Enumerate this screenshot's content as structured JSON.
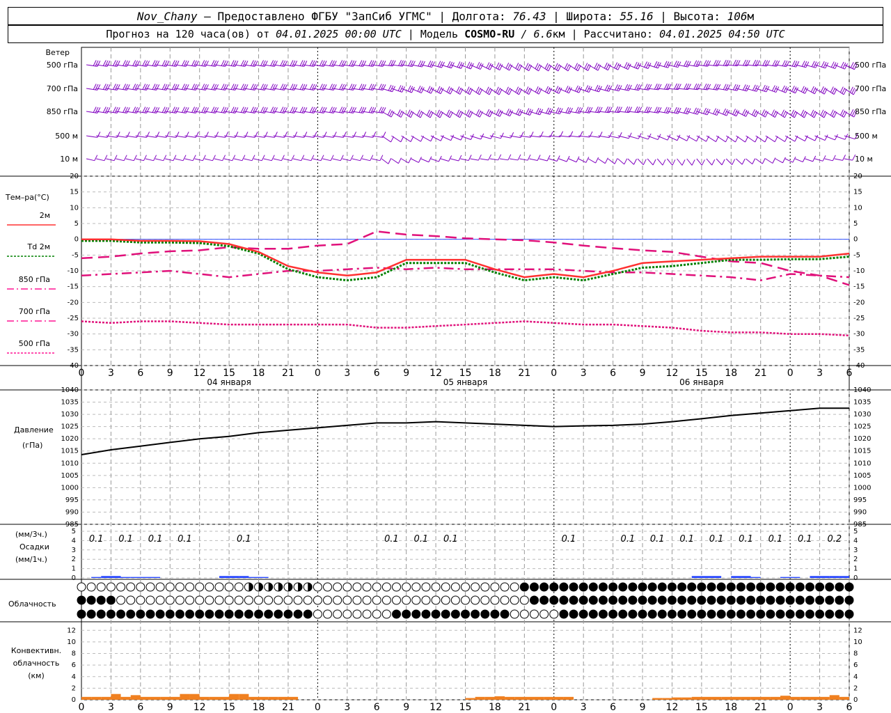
{
  "header": {
    "station": "Nov_Chany",
    "dash": " – ",
    "provider": "Предоставлено ФГБУ \"ЗапСиб УГМС\"",
    "sep": " | ",
    "lon_label": "Долгота: ",
    "lon": "76.43",
    "lat_label": "Широта: ",
    "lat": "55.16",
    "alt_label": "Высота: ",
    "alt": "106",
    "alt_unit": "м",
    "forecast_label": "Прогноз на 120 часа(ов) от ",
    "forecast_start": "04.01.2025 00:00 UTC",
    "model_label": " | Модель ",
    "model": "COSMO-RU",
    "model_sep": " / ",
    "resolution": "6.6",
    "resolution_unit": "км",
    "computed_label": " | Рассчитано: ",
    "computed": "04.01.2025 04:50 UTC"
  },
  "wind_panel": {
    "title": "Ветер",
    "levels": [
      "500 гПа",
      "700 гПа",
      "850 гПа",
      "500  м",
      "10  м"
    ],
    "right_levels": [
      "500 гПа",
      "700 гПа",
      "850 гПа",
      "500 м",
      "10 м"
    ],
    "color": "#8000c0",
    "calm_marker_hour": 96
  },
  "temp_panel": {
    "title": "Тем–ра(°C)",
    "legend": [
      {
        "label": "2м",
        "color": "#ff3030",
        "style": "solid"
      },
      {
        "label": "Td  2м",
        "color": "#008000",
        "style": "dotted"
      },
      {
        "label": "850 гПа",
        "color": "#ff1493",
        "style": "dashdot"
      },
      {
        "label": "700 гПа",
        "color": "#ff1493",
        "style": "dashdot"
      },
      {
        "label": "500 гПа",
        "color": "#ff1493",
        "style": "dotted"
      }
    ],
    "yticks": [
      "20",
      "15",
      "10",
      "5",
      "0",
      "-5",
      "-10",
      "-15",
      "-20",
      "-25",
      "-30",
      "-35",
      "-40"
    ]
  },
  "time_axis": {
    "labels": [
      "0",
      "3",
      "6",
      "9",
      "12",
      "15",
      "18",
      "21",
      "0",
      "3",
      "6",
      "9",
      "12",
      "15",
      "18",
      "21",
      "0",
      "3",
      "6",
      "9",
      "12",
      "15",
      "18",
      "21",
      "0",
      "3",
      "6"
    ],
    "dates": [
      "04 января",
      "05 января",
      "06 января"
    ]
  },
  "pressure_panel": {
    "title": "Давление",
    "unit": "(гПа)",
    "yticks": [
      "1040",
      "1035",
      "1030",
      "1025",
      "1020",
      "1015",
      "1010",
      "1005",
      "1000",
      "995",
      "990",
      "985"
    ]
  },
  "precip_panel": {
    "unit_3h": "(мм/3ч.)",
    "title": "Осадки",
    "unit_1h": "(мм/1ч.)",
    "yticks": [
      "5",
      "4",
      "3",
      "2",
      "1",
      "0"
    ],
    "amounts": [
      {
        "hour": 1,
        "text": "0.1"
      },
      {
        "hour": 4,
        "text": "0.1"
      },
      {
        "hour": 7,
        "text": "0.1"
      },
      {
        "hour": 10,
        "text": "0.1"
      },
      {
        "hour": 16,
        "text": "0.1"
      },
      {
        "hour": 31,
        "text": "0.1"
      },
      {
        "hour": 34,
        "text": "0.1"
      },
      {
        "hour": 37,
        "text": "0.1"
      },
      {
        "hour": 49,
        "text": "0.1"
      },
      {
        "hour": 55,
        "text": "0.1"
      },
      {
        "hour": 58,
        "text": "0.1"
      },
      {
        "hour": 61,
        "text": "0.1"
      },
      {
        "hour": 64,
        "text": "0.1"
      },
      {
        "hour": 67,
        "text": "0.1"
      },
      {
        "hour": 70,
        "text": "0.1"
      },
      {
        "hour": 73,
        "text": "0.1"
      },
      {
        "hour": 76,
        "text": "0.2"
      }
    ]
  },
  "cloud_panel": {
    "title": "Облачность"
  },
  "conv_panel": {
    "title_lines": [
      "Конвективн.",
      "облачность",
      "(км)"
    ],
    "yticks": [
      "12",
      "10",
      "8",
      "6",
      "4",
      "2",
      "0"
    ]
  },
  "chart_data": {
    "type": "line",
    "x_hours": [
      0,
      3,
      6,
      9,
      12,
      15,
      18,
      21,
      24,
      27,
      30,
      33,
      36,
      39,
      42,
      45,
      48,
      51,
      54,
      57,
      60,
      63,
      66,
      69,
      72,
      75,
      78
    ],
    "t2m": [
      0,
      0,
      -0.5,
      -0.5,
      -0.6,
      -1.5,
      -4,
      -8.5,
      -10.5,
      -11.5,
      -10.5,
      -6.5,
      -6.5,
      -6.5,
      -9.5,
      -12,
      -11,
      -12,
      -10,
      -7.5,
      -7,
      -6.5,
      -6,
      -5.5,
      -5.5,
      -5.5,
      -4.5
    ],
    "td2m": [
      -0.5,
      -0.5,
      -1,
      -1,
      -1.2,
      -2.2,
      -4.5,
      -9.5,
      -12,
      -13,
      -12,
      -7.5,
      -7.5,
      -7.5,
      -10.5,
      -13,
      -12,
      -13,
      -11,
      -9,
      -8.5,
      -7.5,
      -6.5,
      -6.5,
      -6.3,
      -6.3,
      -5.5
    ],
    "t850": [
      -6,
      -5.5,
      -4.5,
      -3.8,
      -3.5,
      -2.5,
      -3,
      -3,
      -2,
      -1.5,
      2.5,
      1.5,
      1,
      0.3,
      0,
      -0.3,
      -1,
      -2,
      -2.8,
      -3.5,
      -4,
      -5.5,
      -7,
      -7.5,
      -10,
      -11.5,
      -14.5
    ],
    "t700": [
      -11.5,
      -11,
      -10.5,
      -10,
      -11,
      -12,
      -11,
      -10,
      -10,
      -9.5,
      -9,
      -9.5,
      -9,
      -9.5,
      -9.5,
      -9.5,
      -9.5,
      -10,
      -10.5,
      -10.5,
      -11,
      -11.5,
      -12,
      -13,
      -11,
      -11.5,
      -12
    ],
    "t500": [
      -26,
      -26.5,
      -26,
      -26,
      -26.5,
      -27,
      -27,
      -27,
      -27,
      -27,
      -28,
      -28,
      -27.5,
      -27,
      -26.5,
      -26,
      -26.5,
      -27,
      -27,
      -27.5,
      -28,
      -29,
      -29.5,
      -29.5,
      -30,
      -30,
      -30.5
    ],
    "pressure": [
      1013.5,
      1015.5,
      1017,
      1018.5,
      1020,
      1021,
      1022.5,
      1023.5,
      1024.5,
      1025.5,
      1026.5,
      1026.5,
      1027,
      1026.5,
      1026,
      1025.5,
      1025,
      1025.3,
      1025.5,
      1026,
      1027,
      1028.2,
      1029.5,
      1030.5,
      1031.5,
      1032.5,
      1032.5
    ],
    "precip_1h": [
      0,
      0.1,
      0.2,
      0.2,
      0.1,
      0.1,
      0.1,
      0.1,
      0,
      0,
      0,
      0,
      0,
      0,
      0.2,
      0.2,
      0.2,
      0.1,
      0.1,
      0,
      0,
      0,
      0,
      0,
      0,
      0,
      0,
      0,
      0,
      0,
      0,
      0,
      0,
      0,
      0,
      0,
      0,
      0,
      0,
      0,
      0,
      0,
      0,
      0,
      0,
      0,
      0,
      0,
      0,
      0,
      0,
      0,
      0,
      0,
      0,
      0,
      0,
      0,
      0,
      0,
      0,
      0,
      0.2,
      0.2,
      0.2,
      0,
      0.2,
      0.2,
      0.1,
      0,
      0,
      0.1,
      0.1,
      0,
      0.2,
      0.2,
      0.2,
      0.2
    ],
    "convective_km": [
      0.5,
      0.5,
      0.5,
      1,
      0.5,
      0.8,
      0.5,
      0.5,
      0.5,
      0.5,
      1,
      1,
      0.5,
      0.5,
      0.5,
      1,
      1,
      0.5,
      0.5,
      0.5,
      0.5,
      0.5,
      0,
      0,
      0,
      0,
      0,
      0,
      0,
      0,
      0,
      0,
      0,
      0,
      0,
      0,
      0,
      0,
      0,
      0.3,
      0.5,
      0.5,
      0.6,
      0.5,
      0.5,
      0.5,
      0.5,
      0.5,
      0.5,
      0.5,
      0,
      0,
      0,
      0,
      0,
      0,
      0,
      0,
      0.3,
      0.3,
      0.4,
      0.4,
      0.5,
      0.5,
      0.5,
      0.5,
      0.5,
      0.5,
      0.5,
      0.5,
      0.5,
      0.7,
      0.5,
      0.5,
      0.5,
      0.5,
      0.8,
      0.5
    ],
    "ylim_temp": [
      -40,
      20
    ],
    "ylim_pressure": [
      985,
      1040
    ],
    "ylim_precip": [
      0,
      5
    ],
    "ylim_conv": [
      0,
      13
    ]
  }
}
